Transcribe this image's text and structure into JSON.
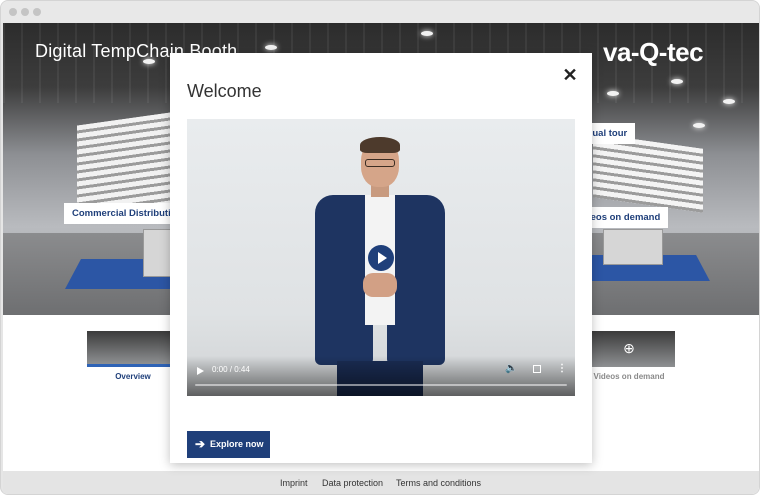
{
  "booth": {
    "title": "Digital TempChain Booth",
    "brand": "va-Q-tec",
    "hotspots": {
      "commercial": "Commercial Distribution",
      "tour": "ividual tour",
      "videos": "Videos on demand"
    }
  },
  "thumbnails": [
    {
      "label": "Overview",
      "active": true
    },
    {
      "label": "Videos on demand",
      "active": false
    }
  ],
  "modal": {
    "title": "Welcome",
    "close_icon": "close-icon",
    "video": {
      "time": "0:00 / 0:44",
      "volume_icon": "🔈",
      "more_icon": "⋮",
      "progress": 0
    },
    "explore_label": "Explore now",
    "explore_icon": "➔"
  },
  "footer": {
    "imprint": "Imprint",
    "data_protection": "Data protection",
    "terms": "Terms and conditions"
  },
  "colors": {
    "accent": "#1f3f7a",
    "carpet": "#2c56a5"
  }
}
